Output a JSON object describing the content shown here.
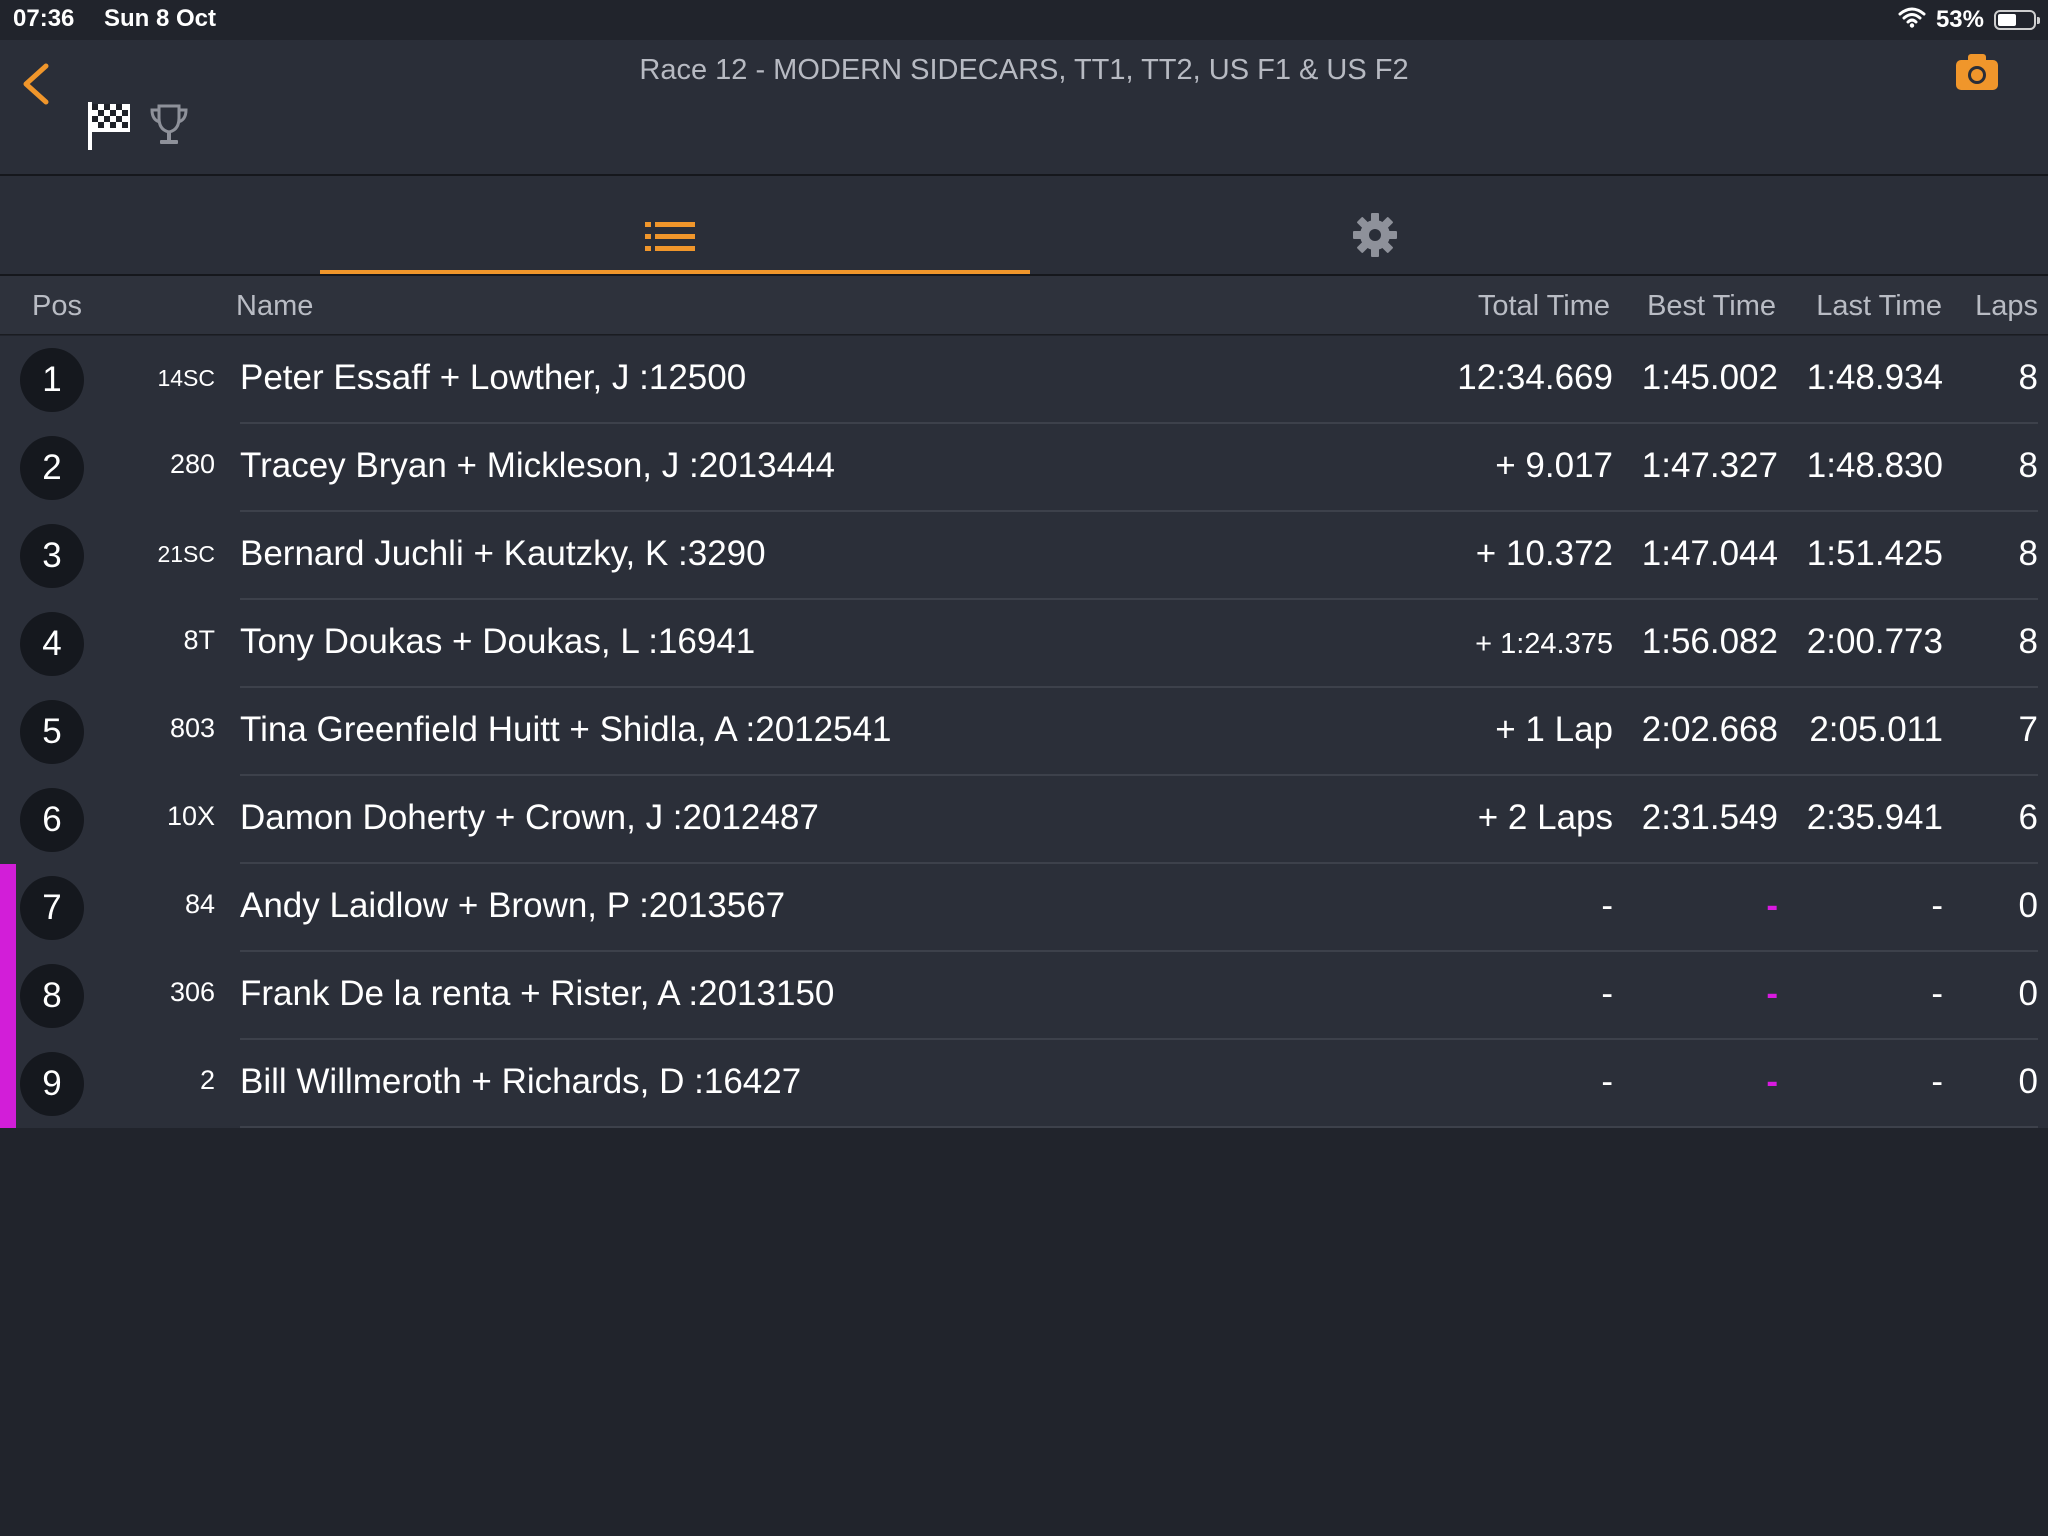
{
  "status_bar": {
    "time": "07:36",
    "date": "Sun 8 Oct",
    "battery_percent": "53%",
    "battery_level": 0.53
  },
  "header": {
    "title": "Race 12 - MODERN SIDECARS, TT1, TT2, US F1 & US F2"
  },
  "colors": {
    "accent": "#f0962b",
    "highlight": "#d21ed8",
    "background": "#21242c",
    "panel": "#2b2f39"
  },
  "tabs": [
    {
      "icon": "list-icon",
      "active": true
    },
    {
      "icon": "gear-icon",
      "active": false
    }
  ],
  "columns": {
    "pos": "Pos",
    "name": "Name",
    "total": "Total Time",
    "best": "Best Time",
    "last": "Last Time",
    "laps": "Laps"
  },
  "results": [
    {
      "pos": "1",
      "number": "14SC",
      "name": "Peter Essaff + Lowther, J :12500",
      "total": "12:34.669",
      "best": "1:45.002",
      "last": "1:48.934",
      "laps": "8",
      "flagged": false
    },
    {
      "pos": "2",
      "number": "280",
      "name": "Tracey Bryan + Mickleson, J :2013444",
      "total": "+ 9.017",
      "best": "1:47.327",
      "last": "1:48.830",
      "laps": "8",
      "flagged": false
    },
    {
      "pos": "3",
      "number": "21SC",
      "name": "Bernard Juchli + Kautzky, K :3290",
      "total": "+ 10.372",
      "best": "1:47.044",
      "last": "1:51.425",
      "laps": "8",
      "flagged": false
    },
    {
      "pos": "4",
      "number": "8T",
      "name": "Tony Doukas + Doukas, L :16941",
      "total": "+ 1:24.375",
      "best": "1:56.082",
      "last": "2:00.773",
      "laps": "8",
      "flagged": false
    },
    {
      "pos": "5",
      "number": "803",
      "name": "Tina Greenfield Huitt + Shidla, A :2012541",
      "total": "+ 1 Lap",
      "best": "2:02.668",
      "last": "2:05.011",
      "laps": "7",
      "flagged": false
    },
    {
      "pos": "6",
      "number": "10X",
      "name": "Damon Doherty + Crown, J :2012487",
      "total": "+ 2 Laps",
      "best": "2:31.549",
      "last": "2:35.941",
      "laps": "6",
      "flagged": false
    },
    {
      "pos": "7",
      "number": "84",
      "name": "Andy Laidlow + Brown, P :2013567",
      "total": "-",
      "best": "-",
      "last": "-",
      "laps": "0",
      "flagged": true
    },
    {
      "pos": "8",
      "number": "306",
      "name": "Frank De la renta + Rister, A :2013150",
      "total": "-",
      "best": "-",
      "last": "-",
      "laps": "0",
      "flagged": true
    },
    {
      "pos": "9",
      "number": "2",
      "name": "Bill Willmeroth + Richards, D :16427",
      "total": "-",
      "best": "-",
      "last": "-",
      "laps": "0",
      "flagged": true
    }
  ]
}
